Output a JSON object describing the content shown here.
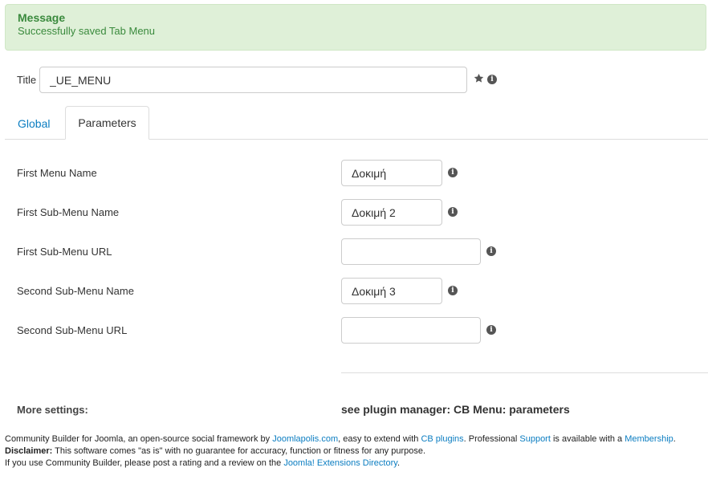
{
  "message": {
    "title": "Message",
    "text": "Successfully saved Tab Menu"
  },
  "title_field": {
    "label": "Title",
    "value": "_UE_MENU"
  },
  "tabs": {
    "global": "Global",
    "parameters": "Parameters"
  },
  "params": [
    {
      "label": "First Menu Name",
      "value": "Δοκιμή"
    },
    {
      "label": "First Sub-Menu Name",
      "value": "Δοκιμή 2"
    },
    {
      "label": "First Sub-Menu URL",
      "value": ""
    },
    {
      "label": "Second Sub-Menu Name",
      "value": "Δοκιμή 3"
    },
    {
      "label": "Second Sub-Menu URL",
      "value": ""
    }
  ],
  "more_settings": {
    "label": "More settings:",
    "value": "see plugin manager: CB Menu: parameters"
  },
  "footer": {
    "line1": {
      "t1": "Community Builder for Joomla, an open-source social framework by ",
      "l1": "Joomlapolis.com",
      "t2": ", easy to extend with ",
      "l2": "CB plugins",
      "t3": ". Professional ",
      "l3": "Support",
      "t4": " is available with a ",
      "l4": "Membership",
      "t5": "."
    },
    "line2": {
      "bold": "Disclaimer:",
      "text": " This software comes \"as is\" with no guarantee for accuracy, function or fitness for any purpose."
    },
    "line3": {
      "t1": "If you use Community Builder, please post a rating and a review on the ",
      "l1": "Joomla! Extensions Directory",
      "t2": "."
    }
  },
  "icons": {
    "info": "i",
    "star": "star-icon"
  },
  "colors": {
    "alert_bg": "#dff0d8",
    "alert_text": "#3a8a3d",
    "link": "#0b7dc1"
  }
}
